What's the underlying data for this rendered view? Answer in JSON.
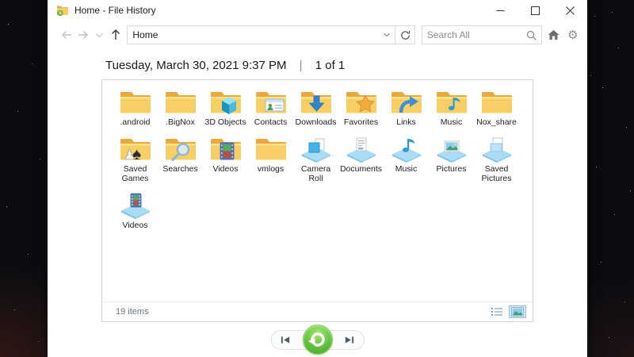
{
  "window": {
    "title": "Home - File History"
  },
  "toolbar": {
    "address_value": "Home",
    "search_placeholder": "Search All"
  },
  "heading": {
    "date": "Tuesday, March 30, 2021 9:37 PM",
    "separator": "|",
    "position": "1 of 1"
  },
  "content": {
    "status": "19 items",
    "items": [
      {
        "label": ".android",
        "icon": "folder"
      },
      {
        "label": ".BigNox",
        "icon": "folder"
      },
      {
        "label": "3D Objects",
        "icon": "folder-3d-objects"
      },
      {
        "label": "Contacts",
        "icon": "folder-contacts"
      },
      {
        "label": "Downloads",
        "icon": "folder-downloads"
      },
      {
        "label": "Favorites",
        "icon": "folder-favorites"
      },
      {
        "label": "Links",
        "icon": "folder-links"
      },
      {
        "label": "Music",
        "icon": "folder-music"
      },
      {
        "label": "Nox_share",
        "icon": "folder"
      },
      {
        "label": "Saved Games",
        "icon": "folder-saved-games"
      },
      {
        "label": "Searches",
        "icon": "folder-searches"
      },
      {
        "label": "Videos",
        "icon": "folder-videos"
      },
      {
        "label": "vmlogs",
        "icon": "folder"
      },
      {
        "label": "Camera Roll",
        "icon": "library-camera-roll"
      },
      {
        "label": "Documents",
        "icon": "library-documents"
      },
      {
        "label": "Music",
        "icon": "library-music"
      },
      {
        "label": "Pictures",
        "icon": "library-pictures"
      },
      {
        "label": "Saved Pictures",
        "icon": "library-saved-pictures"
      },
      {
        "label": "Videos",
        "icon": "library-videos"
      }
    ]
  },
  "icons": {
    "gear": "⚙",
    "back": "left-arrow",
    "forward": "right-arrow",
    "recent-locations": "chevron-down",
    "up": "up-arrow",
    "refresh": "circular-arrow",
    "search": "magnifier",
    "home": "house",
    "previous-version": "skip-to-start",
    "restore": "green-circular-arrow",
    "next-version": "skip-to-end"
  },
  "colors": {
    "accent_green": "#4cb52e",
    "folder_yellow": "#f7cf64",
    "library_blue": "#abdcf5",
    "selection_blue": "#cfe8fb"
  }
}
